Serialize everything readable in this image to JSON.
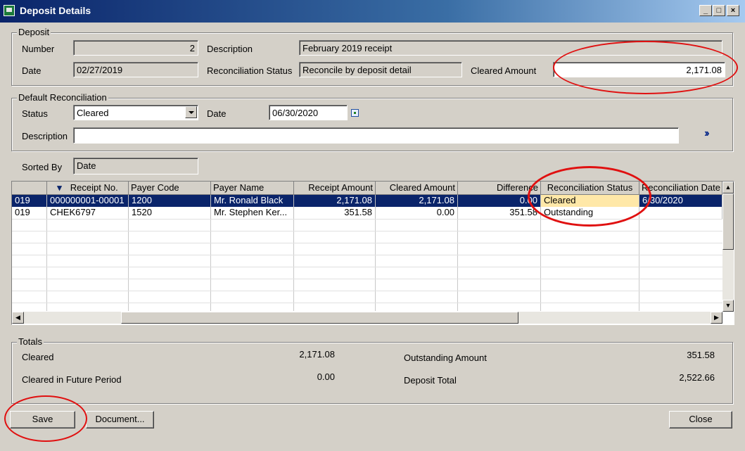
{
  "window": {
    "title": "Deposit Details",
    "controls": [
      "_",
      "□",
      "×"
    ]
  },
  "deposit": {
    "legend": "Deposit",
    "number_label": "Number",
    "number_value": "2",
    "description_label": "Description",
    "description_value": "February 2019 receipt",
    "date_label": "Date",
    "date_value": "02/27/2019",
    "recon_status_label": "Reconciliation Status",
    "recon_status_value": "Reconcile by deposit detail",
    "cleared_amount_label": "Cleared Amount",
    "cleared_amount_value": "2,171.08"
  },
  "default_recon": {
    "legend": "Default Reconciliation",
    "status_label": "Status",
    "status_value": "Cleared",
    "date_label": "Date",
    "date_value": "06/30/2020",
    "description_label": "Description",
    "description_value": "",
    "apply_icon": "double-chevron-right-icon"
  },
  "sorted_by": {
    "label": "Sorted By",
    "value": "Date"
  },
  "table": {
    "headers": [
      "",
      "Receipt No.",
      "Payer Code",
      "Payer Name",
      "Receipt Amount",
      "Cleared Amount",
      "Difference",
      "Reconciliation Status",
      "Reconciliation Date"
    ],
    "rows": [
      [
        "019",
        "000000001-00001",
        "1200",
        "Mr. Ronald Black",
        "2,171.08",
        "2,171.08",
        "0.00",
        "Cleared",
        "6/30/2020"
      ],
      [
        "019",
        "CHEK6797",
        "1520",
        "Mr. Stephen Ker...",
        "351.58",
        "0.00",
        "351.58",
        "Outstanding",
        ""
      ]
    ]
  },
  "totals": {
    "legend": "Totals",
    "cleared_label": "Cleared",
    "cleared_value": "2,171.08",
    "future_label": "Cleared in Future Period",
    "future_value": "0.00",
    "outstanding_label": "Outstanding Amount",
    "outstanding_value": "351.58",
    "deposit_total_label": "Deposit Total",
    "deposit_total_value": "2,522.66"
  },
  "buttons": {
    "save": "Save",
    "document": "Document...",
    "close": "Close"
  },
  "colors": {
    "title_bar": "#0a246a",
    "selection": "#0a246a",
    "highlight_cell": "#ffe8a8",
    "annotation": "#e01010"
  }
}
